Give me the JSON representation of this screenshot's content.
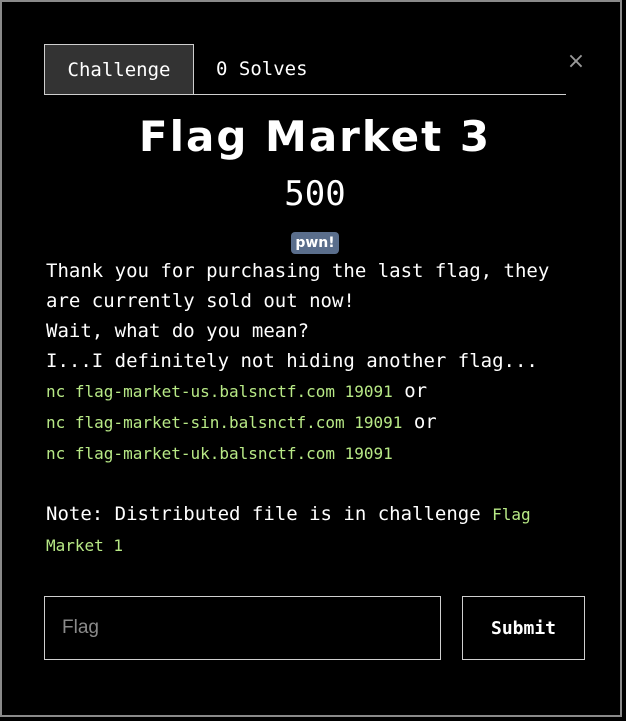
{
  "tabs": [
    {
      "label": "Challenge"
    },
    {
      "label": "0 Solves"
    }
  ],
  "close_glyph": "×",
  "challenge": {
    "title": "Flag Market 3",
    "points": "500",
    "tag": "pwn!"
  },
  "description": {
    "line1": "Thank you for purchasing the last flag, they are currently sold out now!",
    "line2": "Wait, what do you mean?",
    "line3": "I...I definitely not hiding another flag...",
    "connections": [
      {
        "command": "nc flag-market-us.balsnctf.com 19091",
        "suffix": " or"
      },
      {
        "command": "nc flag-market-sin.balsnctf.com 19091",
        "suffix": " or"
      },
      {
        "command": "nc flag-market-uk.balsnctf.com 19091",
        "suffix": ""
      }
    ],
    "note_prefix": "Note: Distributed file is in challenge ",
    "note_link": "Flag Market 1"
  },
  "form": {
    "placeholder": "Flag",
    "value": "",
    "submit_label": "Submit"
  },
  "colors": {
    "accent_green": "#b8e986",
    "tag_bg": "#5a6e8c"
  }
}
